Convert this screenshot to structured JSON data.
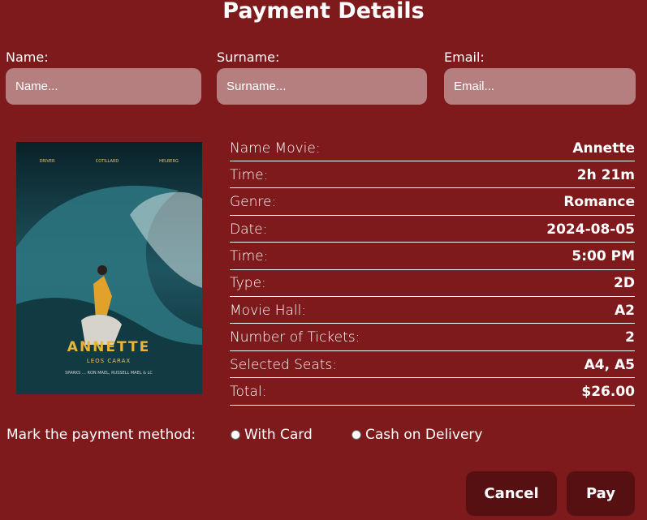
{
  "page": {
    "title": "Payment Details"
  },
  "form": {
    "name": {
      "label": "Name:",
      "placeholder": "Name..."
    },
    "surname": {
      "label": "Surname:",
      "placeholder": "Surname..."
    },
    "email": {
      "label": "Email:",
      "placeholder": "Email..."
    }
  },
  "poster": {
    "title": "ANNETTE",
    "director": "LEOS CARAX",
    "credits": "SPARKS … RON MAEL, RUSSELL MAEL & LC",
    "cast": [
      "DRIVER",
      "COTILLARD",
      "HELBERG"
    ]
  },
  "details": [
    {
      "key": "Name Movie:",
      "value": "Annette"
    },
    {
      "key": "Time:",
      "value": "2h 21m"
    },
    {
      "key": "Genre:",
      "value": "Romance"
    },
    {
      "key": "Date:",
      "value": "2024-08-05"
    },
    {
      "key": "Time:",
      "value": "5:00 PM"
    },
    {
      "key": "Type:",
      "value": "2D"
    },
    {
      "key": "Movie Hall:",
      "value": "A2"
    },
    {
      "key": "Number of Tickets:",
      "value": "2"
    },
    {
      "key": "Selected Seats:",
      "value": "A4, A5"
    },
    {
      "key": "Total:",
      "value": "$26.00"
    }
  ],
  "payment": {
    "label": "Mark the payment method:",
    "options": [
      "With Card",
      "Cash on Delivery"
    ]
  },
  "actions": {
    "cancel": "Cancel",
    "pay": "Pay"
  },
  "colors": {
    "background": "#7e1a1b",
    "input": "#b57e7f",
    "button": "#561011"
  }
}
